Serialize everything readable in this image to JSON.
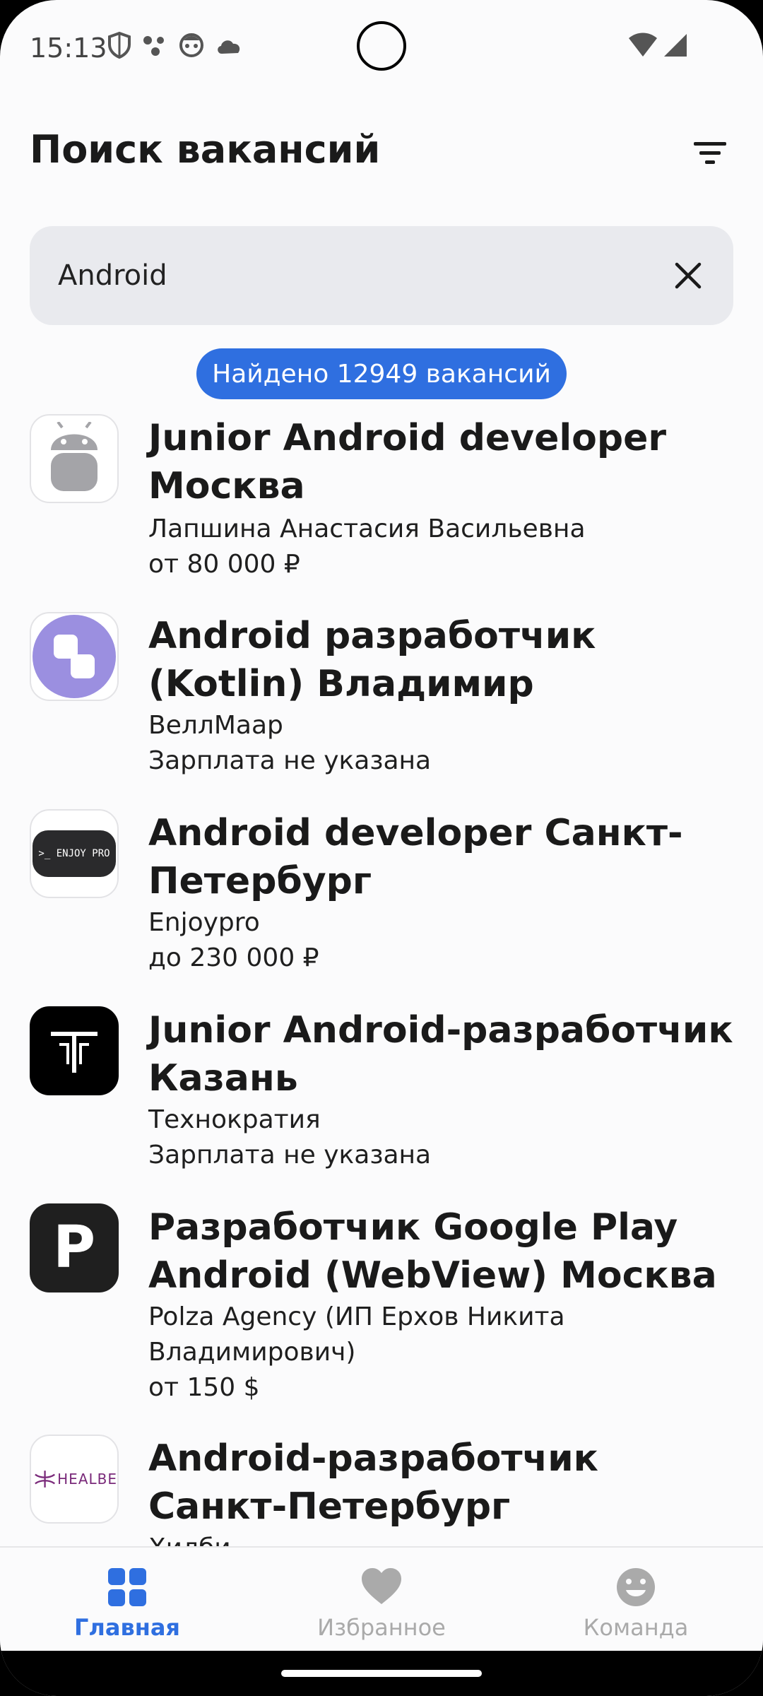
{
  "status_bar": {
    "time": "15:13"
  },
  "header": {
    "title": "Поиск вакансий"
  },
  "search": {
    "value": "Android"
  },
  "found": {
    "label": "Найдено 12949 вакансий"
  },
  "vacancies": [
    {
      "title": "Junior Android developer Москва",
      "company": "Лапшина Анастасия Васильевна",
      "salary": "от 80 000 ₽",
      "logo": "android-robot-icon"
    },
    {
      "title": "Android разработчик (Kotlin) Владимир",
      "company": "ВеллМаар",
      "salary": "Зарплата не указана",
      "logo": "wellmaar-logo"
    },
    {
      "title": "Android developer Санкт-Петербург",
      "company": "Enjoypro",
      "salary": "до 230 000 ₽",
      "logo": "enjoypro-logo",
      "logo_text": ">_ ENJOY PRO"
    },
    {
      "title": "Junior Android-разработчик Казань",
      "company": "Технократия",
      "salary": "Зарплата не указана",
      "logo": "technokratia-logo"
    },
    {
      "title": "Разработчик Google Play Android (WebView) Москва",
      "company": "Polza Agency (ИП Ерхов Никита Владимирович)",
      "salary": "от 150 $",
      "logo": "polza-logo",
      "logo_text": "P"
    },
    {
      "title": "Android-разработчик Санкт-Петербург",
      "company": "Хилби",
      "salary": "",
      "logo": "healbe-logo",
      "logo_text": "HEALBE"
    }
  ],
  "bottom_nav": [
    {
      "label": "Главная",
      "icon": "grid-icon",
      "active": true
    },
    {
      "label": "Избранное",
      "icon": "heart-icon",
      "active": false
    },
    {
      "label": "Команда",
      "icon": "smiley-icon",
      "active": false
    }
  ],
  "colors": {
    "accent": "#2f6fe0",
    "background": "#fbfbfc",
    "search_bg": "#e9eaee",
    "inactive": "#aaaaaa",
    "wellmaar": "#9b8fe0"
  }
}
